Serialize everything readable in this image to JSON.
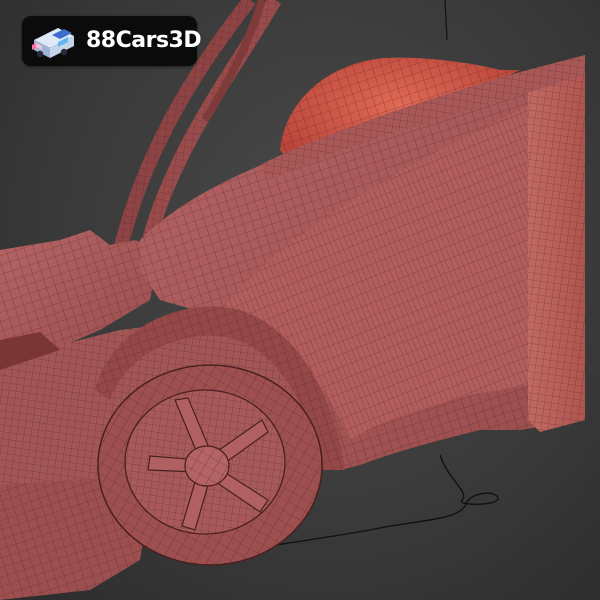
{
  "brand": {
    "name": "88Cars3D",
    "icon": "van-icon",
    "badge_color": "#0b0b0b",
    "text_color": "#ffffff"
  },
  "render": {
    "subject": "wireframe-model-lawn-mower",
    "mesh_color": "#a85a5a",
    "wire_color": "#4a1f1f",
    "background_color": "#3d3d3d"
  }
}
